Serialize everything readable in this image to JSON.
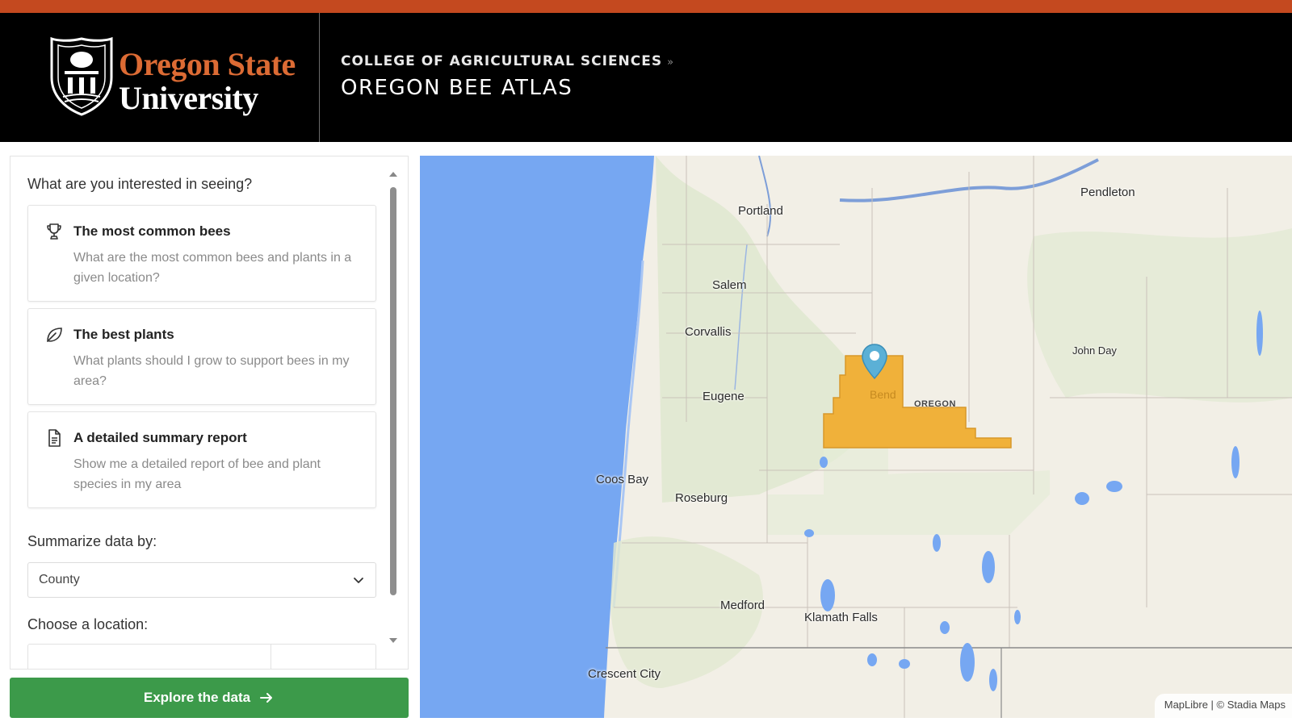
{
  "header": {
    "university_line1": "Oregon State",
    "university_line2": "University",
    "breadcrumb_parent": "COLLEGE OF AGRICULTURAL SCIENCES",
    "breadcrumb_separator": "»",
    "title": "OREGON BEE ATLAS"
  },
  "panel": {
    "question": "What are you interested in seeing?",
    "options": [
      {
        "title": "The most common bees",
        "description": "What are the most common bees and plants in a given location?",
        "icon": "trophy-icon"
      },
      {
        "title": "The best plants",
        "description": "What plants should I grow to support bees in my area?",
        "icon": "leaf-icon"
      },
      {
        "title": "A detailed summary report",
        "description": "Show me a detailed report of bee and plant species in my area",
        "icon": "document-icon"
      }
    ],
    "summarize_label": "Summarize data by:",
    "summarize_value": "County",
    "location_label": "Choose a location:"
  },
  "explore_button": {
    "label": "Explore the data"
  },
  "map": {
    "cities": [
      "Portland",
      "Salem",
      "Corvallis",
      "Eugene",
      "Bend",
      "Coos Bay",
      "Roseburg",
      "Medford",
      "Klamath Falls",
      "Crescent City",
      "Pendleton",
      "John Day"
    ],
    "state_label": "OREGON",
    "attribution": "MapLibre | © Stadia Maps",
    "highlight_color": "#f0b13a",
    "water_color": "#76a7f2"
  },
  "colors": {
    "accent_bar": "#c4491f",
    "osu_orange": "#dc6b34",
    "button_green": "#3c9a4a"
  }
}
